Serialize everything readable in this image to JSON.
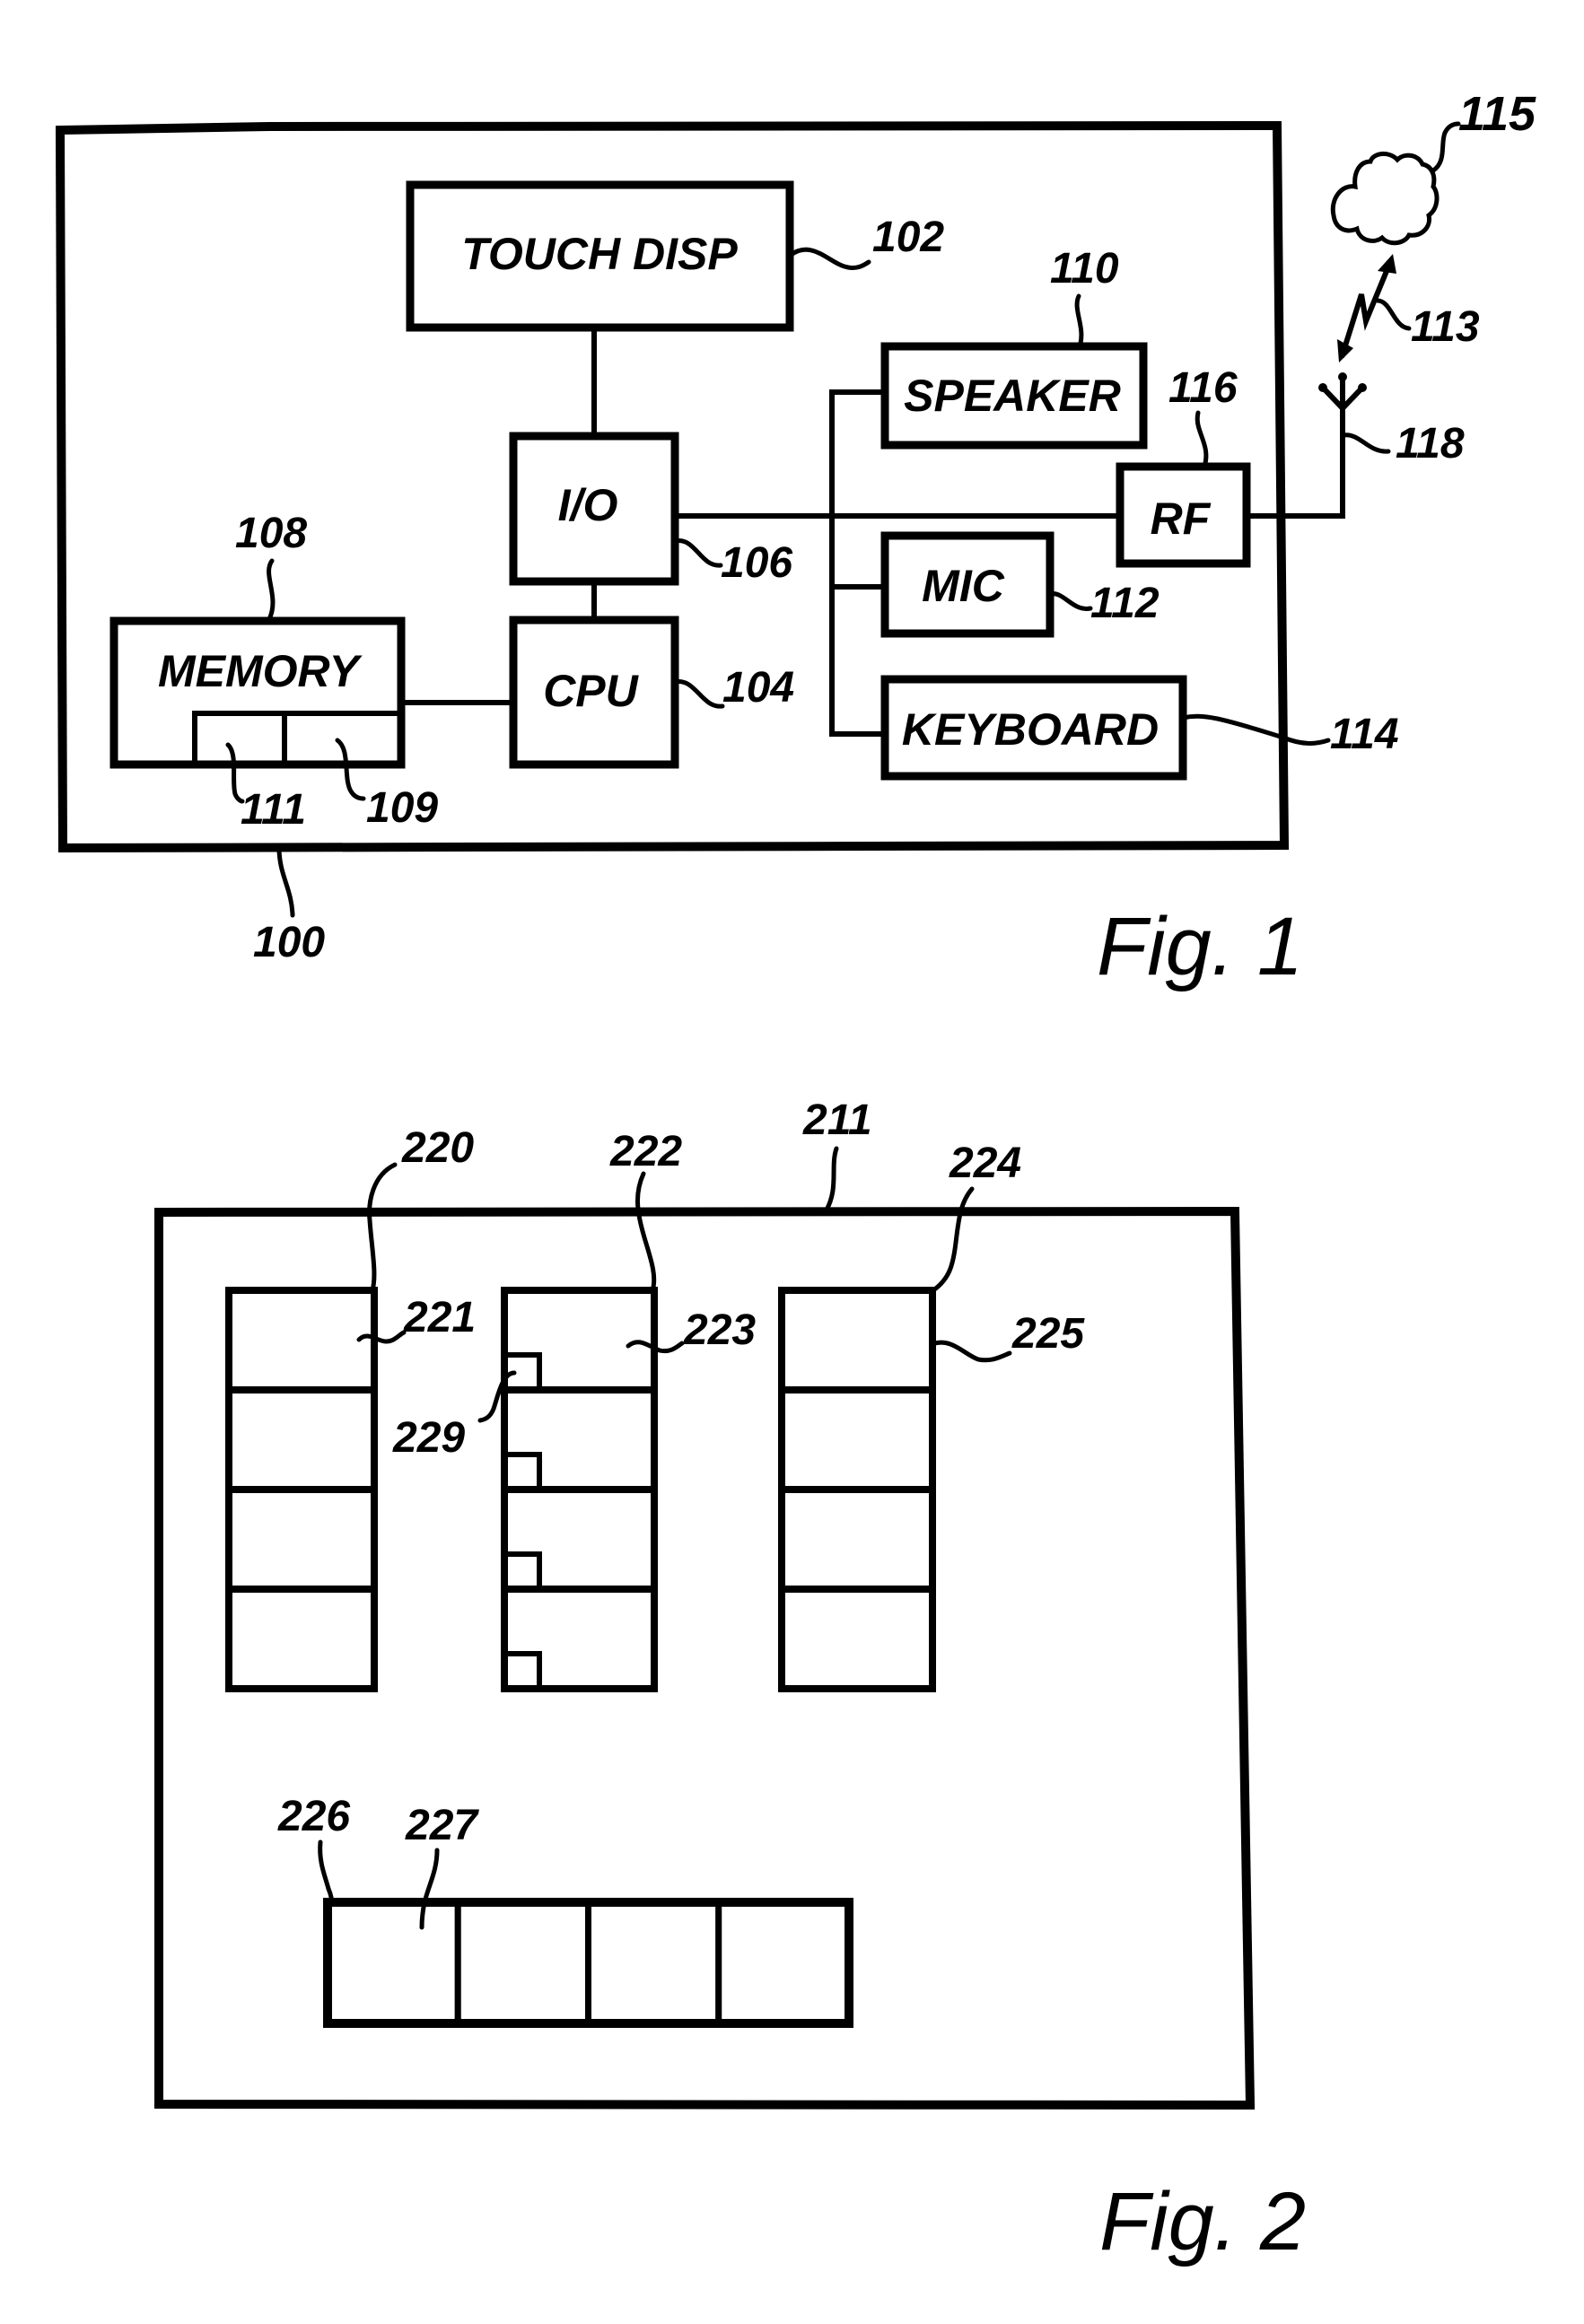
{
  "figures": [
    {
      "id": "fig1",
      "title": "Fig. 1",
      "device_ref": "100",
      "blocks": {
        "touch_display": {
          "label": "TOUCH DISP",
          "ref": "102"
        },
        "io": {
          "label": "I/O",
          "ref": "106"
        },
        "cpu": {
          "label": "CPU",
          "ref": "104"
        },
        "memory": {
          "label": "MEMORY",
          "ref": "108",
          "sub_refs": [
            "111",
            "109"
          ]
        },
        "speaker": {
          "label": "SPEAKER",
          "ref": "110"
        },
        "rf": {
          "label": "RF",
          "ref": "116"
        },
        "mic": {
          "label": "MIC",
          "ref": "112"
        },
        "keyboard": {
          "label": "KEYBOARD",
          "ref": "114"
        }
      },
      "antenna_ref": "118",
      "wireless_link_ref": "113",
      "network_ref": "115"
    },
    {
      "id": "fig2",
      "title": "Fig. 2",
      "screen_ref": "211",
      "columns": [
        {
          "ref": "220",
          "item_ref": "221",
          "rows": 4,
          "has_markers": false
        },
        {
          "ref": "222",
          "item_ref": "223",
          "rows": 4,
          "has_markers": true,
          "marker_ref": "229"
        },
        {
          "ref": "224",
          "item_ref": "225",
          "rows": 4,
          "has_markers": false
        }
      ],
      "row_strip": {
        "ref": "226",
        "item_ref": "227",
        "cells": 4
      }
    }
  ]
}
